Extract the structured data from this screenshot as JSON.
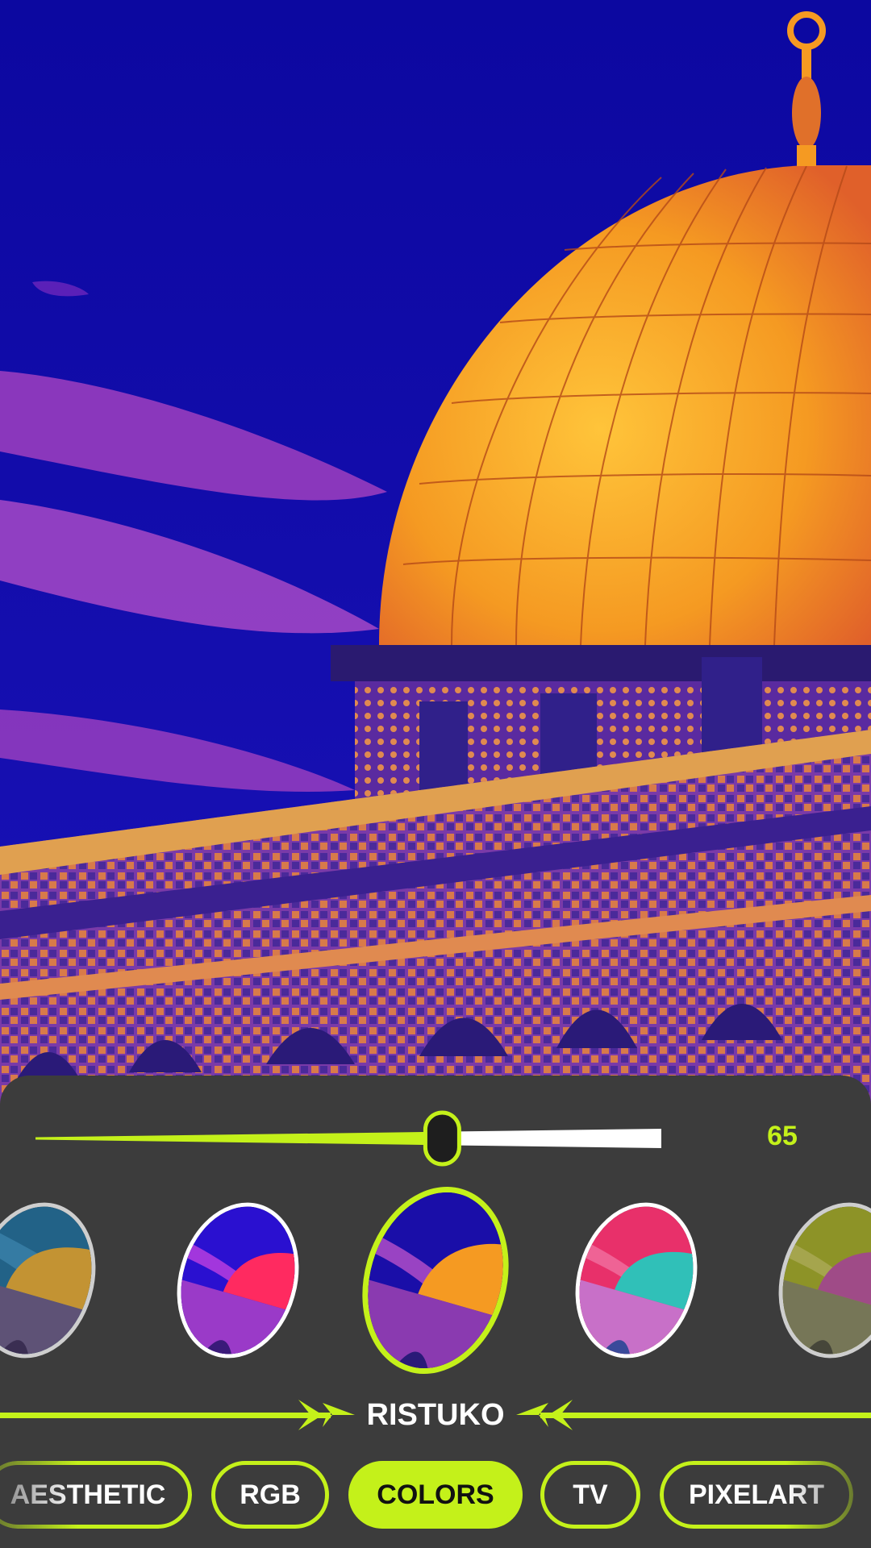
{
  "editor": {
    "intensity_value": "65",
    "intensity_fraction": 0.65,
    "selected_filter_name": "RISTUKO"
  },
  "filters": [
    {
      "id": "filter-gold",
      "selected": false
    },
    {
      "id": "filter-red",
      "selected": false
    },
    {
      "id": "filter-ristuko",
      "selected": true
    },
    {
      "id": "filter-teal",
      "selected": false
    },
    {
      "id": "filter-green",
      "selected": false
    }
  ],
  "categories": [
    {
      "label": "AESTHETIC",
      "active": false
    },
    {
      "label": "RGB",
      "active": false
    },
    {
      "label": "COLORS",
      "active": true
    },
    {
      "label": "TV",
      "active": false
    },
    {
      "label": "PIXELART",
      "active": false
    }
  ],
  "colors": {
    "accent": "#c4f11a",
    "panel_bg": "#3c3c3c",
    "sky": "#0d0a9a",
    "dome": "#f59a22"
  },
  "icons": {
    "arrow_left": "arrow-right-indicator-icon",
    "arrow_right": "arrow-left-indicator-icon"
  }
}
